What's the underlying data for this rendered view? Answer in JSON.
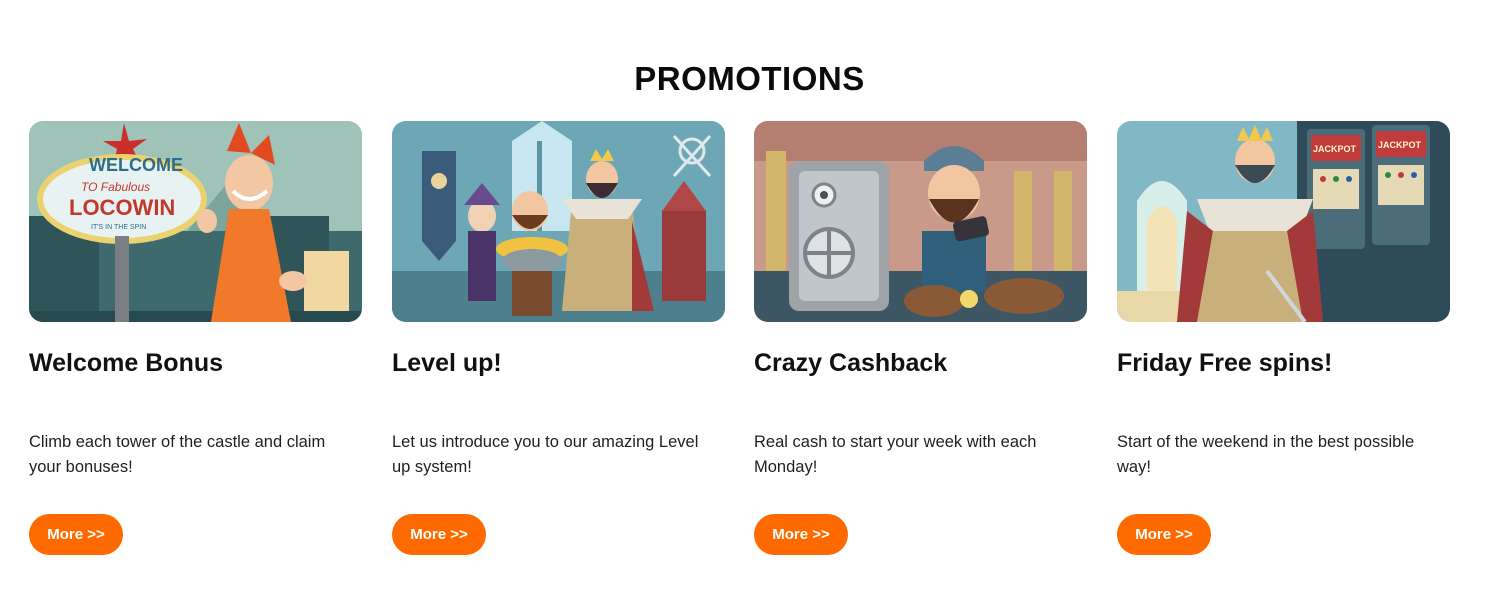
{
  "page": {
    "title": "PROMOTIONS"
  },
  "promotions": [
    {
      "title": "Welcome Bonus",
      "description": "Climb each tower of the castle and claim your bonuses!",
      "button_label": "More >>",
      "image": {
        "subject": "jester-welcome-sign-illustration",
        "sign_text": [
          "WELCOME",
          "TO Fabulous",
          "LOCOWIN",
          "IT'S IN THE SPIN"
        ]
      }
    },
    {
      "title": "Level up!",
      "description": "Let us introduce you to our amazing Level up system!",
      "button_label": "More >>",
      "image": {
        "subject": "jester-knight-king-gold-illustration"
      }
    },
    {
      "title": "Crazy Cashback",
      "description": "Real cash to start your week with each Monday!",
      "button_label": "More >>",
      "image": {
        "subject": "knight-with-safe-illustration"
      }
    },
    {
      "title": "Friday Free spins!",
      "description": "Start of the weekend in the best possible way!",
      "button_label": "More >>",
      "image": {
        "subject": "king-slot-machines-illustration",
        "sign_text": [
          "JACKPOT",
          "JACKPOT"
        ]
      }
    }
  ],
  "colors": {
    "accent": "#ff6a00",
    "text": "#111111",
    "background": "#ffffff"
  }
}
